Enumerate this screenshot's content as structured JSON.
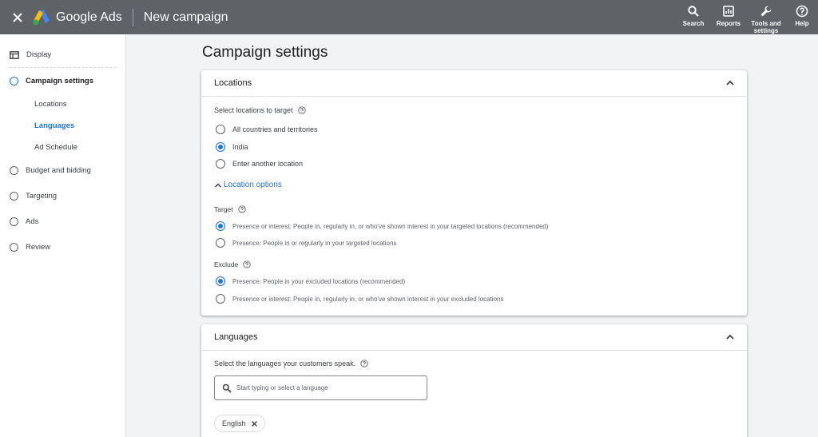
{
  "header": {
    "brand": "Google Ads",
    "page_name": "New campaign",
    "actions": [
      {
        "label": "Search",
        "icon": "search-icon"
      },
      {
        "label": "Reports",
        "icon": "reports-icon"
      },
      {
        "label": "Tools and settings",
        "icon": "wrench-icon"
      },
      {
        "label": "Help",
        "icon": "help-icon"
      }
    ]
  },
  "sidebar": {
    "items": [
      {
        "label": "Display",
        "icon": "display-icon"
      },
      {
        "label": "Campaign settings",
        "active": true
      },
      {
        "label": "Budget and bidding"
      },
      {
        "label": "Targeting"
      },
      {
        "label": "Ads"
      },
      {
        "label": "Review"
      }
    ],
    "subitems": [
      {
        "label": "Locations"
      },
      {
        "label": "Languages",
        "current": true
      },
      {
        "label": "Ad Schedule"
      }
    ]
  },
  "main": {
    "title": "Campaign settings",
    "locations": {
      "title": "Locations",
      "select_label": "Select locations to target",
      "options": [
        {
          "label": "All countries and territories",
          "selected": false
        },
        {
          "label": "India",
          "selected": true
        },
        {
          "label": "Enter another location",
          "selected": false
        }
      ],
      "location_options_label": "Location options",
      "target_label": "Target",
      "target_options": [
        {
          "label": "Presence or interest: People in, regularly in, or who've shown interest in your targeted locations (recommended)",
          "selected": true
        },
        {
          "label": "Presence: People in or regularly in your targeted locations",
          "selected": false
        }
      ],
      "exclude_label": "Exclude",
      "exclude_options": [
        {
          "label": "Presence: People in your excluded locations (recommended)",
          "selected": true
        },
        {
          "label": "Presence or interest: People in, regularly in, or who've shown interest in your excluded locations",
          "selected": false
        }
      ]
    },
    "languages": {
      "title": "Languages",
      "select_label": "Select the languages your customers speak.",
      "search_placeholder": "Start typing or select a language",
      "chips": [
        {
          "label": "English"
        }
      ]
    }
  },
  "colors": {
    "topbar": "#5f6368",
    "accent": "#1a73e8"
  }
}
